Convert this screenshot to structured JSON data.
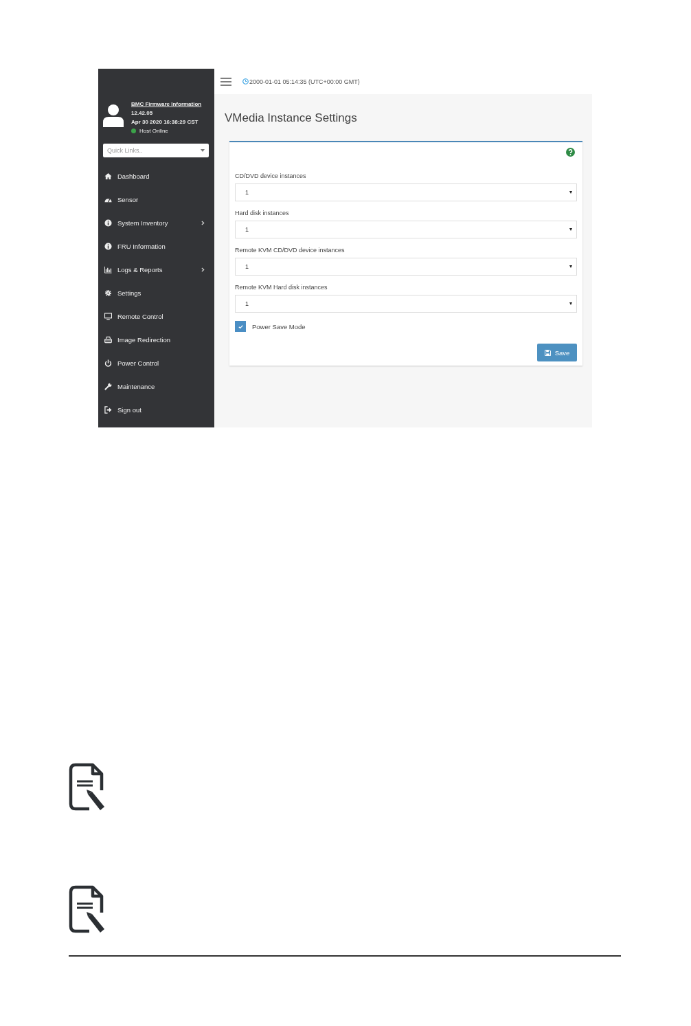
{
  "sidebar": {
    "user": {
      "firmware_link": "BMC Firmware Information",
      "version": "12.42.05",
      "build_date": "Apr 30 2020 16:38:29 CST",
      "host_status": "Host Online",
      "host_online": true
    },
    "quick_links": {
      "placeholder": "Quick Links.."
    },
    "items": [
      {
        "label": "Dashboard",
        "kind": "home",
        "submenu": false
      },
      {
        "label": "Sensor",
        "kind": "gauge",
        "submenu": false
      },
      {
        "label": "System Inventory",
        "kind": "info",
        "submenu": true
      },
      {
        "label": "FRU Information",
        "kind": "info",
        "submenu": false
      },
      {
        "label": "Logs & Reports",
        "kind": "chart",
        "submenu": true
      },
      {
        "label": "Settings",
        "kind": "gear",
        "submenu": false
      },
      {
        "label": "Remote Control",
        "kind": "monitor",
        "submenu": false
      },
      {
        "label": "Image Redirection",
        "kind": "drive",
        "submenu": false
      },
      {
        "label": "Power Control",
        "kind": "power",
        "submenu": false
      },
      {
        "label": "Maintenance",
        "kind": "wrench",
        "submenu": false
      },
      {
        "label": "Sign out",
        "kind": "signout",
        "submenu": false
      }
    ]
  },
  "top_bar": {
    "datetime": "2000-01-01 05:14:35 (UTC+00:00 GMT)"
  },
  "page_title": "VMedia Instance Settings",
  "form": {
    "fields": [
      {
        "label": "CD/DVD device instances",
        "value": "1"
      },
      {
        "label": "Hard disk instances",
        "value": "1"
      },
      {
        "label": "Remote KVM CD/DVD device instances",
        "value": "1"
      },
      {
        "label": "Remote KVM Hard disk instances",
        "value": "1"
      }
    ],
    "power_save": {
      "label": "Power Save Mode",
      "checked": true
    },
    "save_button": "Save"
  },
  "notes": [
    {
      "kind": "note"
    },
    {
      "kind": "note"
    }
  ]
}
